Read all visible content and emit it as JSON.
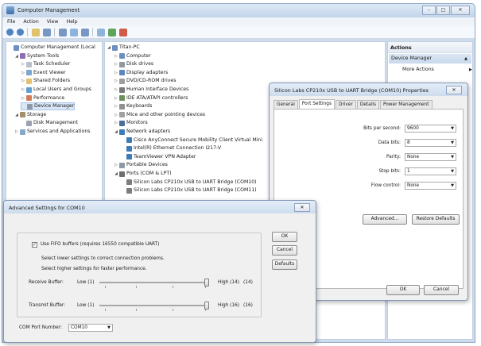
{
  "window": {
    "title": "Computer Management",
    "controls": {
      "minimize": "–",
      "maximize": "□",
      "close": "✕"
    }
  },
  "menu": [
    "File",
    "Action",
    "View",
    "Help"
  ],
  "toolbar_icons": [
    "back-icon",
    "forward-icon",
    "up-folder-icon",
    "show-tree-icon",
    "properties-icon",
    "help-icon",
    "console-icon",
    "scan-icon",
    "enable-icon",
    "disable-icon"
  ],
  "left_tree": [
    {
      "label": "Computer Management (Local",
      "level": 0,
      "tw": "",
      "icon": "c-comp",
      "name": "tree-computer-management"
    },
    {
      "label": "System Tools",
      "level": 1,
      "tw": "◢",
      "icon": "c-tool",
      "name": "tree-system-tools"
    },
    {
      "label": "Task Scheduler",
      "level": 2,
      "tw": "▷",
      "icon": "c-clock",
      "name": "tree-task-scheduler"
    },
    {
      "label": "Event Viewer",
      "level": 2,
      "tw": "▷",
      "icon": "c-log",
      "name": "tree-event-viewer"
    },
    {
      "label": "Shared Folders",
      "level": 2,
      "tw": "▷",
      "icon": "c-share",
      "name": "tree-shared-folders"
    },
    {
      "label": "Local Users and Groups",
      "level": 2,
      "tw": "▷",
      "icon": "c-user",
      "name": "tree-local-users"
    },
    {
      "label": "Performance",
      "level": 2,
      "tw": "▷",
      "icon": "c-perf",
      "name": "tree-performance"
    },
    {
      "label": "Device Manager",
      "level": 2,
      "tw": "",
      "icon": "c-dev",
      "name": "tree-device-manager",
      "selected": true
    },
    {
      "label": "Storage",
      "level": 1,
      "tw": "◢",
      "icon": "c-stor",
      "name": "tree-storage"
    },
    {
      "label": "Disk Management",
      "level": 2,
      "tw": "",
      "icon": "c-disk",
      "name": "tree-disk-management"
    },
    {
      "label": "Services and Applications",
      "level": 1,
      "tw": "▷",
      "icon": "c-svc",
      "name": "tree-services"
    }
  ],
  "device_tree": [
    {
      "label": "Titan-PC",
      "level": 0,
      "tw": "◢",
      "icon": "c-comp"
    },
    {
      "label": "Computer",
      "level": 1,
      "tw": "▷",
      "icon": "c-comp"
    },
    {
      "label": "Disk drives",
      "level": 1,
      "tw": "▷",
      "icon": "c-disk2"
    },
    {
      "label": "Display adapters",
      "level": 1,
      "tw": "▷",
      "icon": "c-disp"
    },
    {
      "label": "DVD/CD-ROM drives",
      "level": 1,
      "tw": "▷",
      "icon": "c-dvd"
    },
    {
      "label": "Human Interface Devices",
      "level": 1,
      "tw": "▷",
      "icon": "c-hid"
    },
    {
      "label": "IDE ATA/ATAPI controllers",
      "level": 1,
      "tw": "▷",
      "icon": "c-ide"
    },
    {
      "label": "Keyboards",
      "level": 1,
      "tw": "▷",
      "icon": "c-kbd"
    },
    {
      "label": "Mice and other pointing devices",
      "level": 1,
      "tw": "▷",
      "icon": "c-mouse"
    },
    {
      "label": "Monitors",
      "level": 1,
      "tw": "▷",
      "icon": "c-mon"
    },
    {
      "label": "Network adapters",
      "level": 1,
      "tw": "◢",
      "icon": "c-net"
    },
    {
      "label": "Cisco AnyConnect Secure Mobility Client Virtual Mini",
      "level": 2,
      "tw": "",
      "icon": "c-net"
    },
    {
      "label": "Intel(R) Ethernet Connection I217-V",
      "level": 2,
      "tw": "",
      "icon": "c-net"
    },
    {
      "label": "TeamViewer VPN Adapter",
      "level": 2,
      "tw": "",
      "icon": "c-net"
    },
    {
      "label": "Portable Devices",
      "level": 1,
      "tw": "▷",
      "icon": "c-dev"
    },
    {
      "label": "Ports (COM & LPT)",
      "level": 1,
      "tw": "◢",
      "icon": "c-port"
    },
    {
      "label": "Silicon Labs CP210x USB to UART Bridge (COM10)",
      "level": 2,
      "tw": "",
      "icon": "c-usb"
    },
    {
      "label": "Silicon Labs CP210x USB to UART Bridge (COM11)",
      "level": 2,
      "tw": "",
      "icon": "c-usb"
    }
  ],
  "actions": {
    "header": "Actions",
    "section": "Device Manager",
    "more": "More Actions"
  },
  "properties_dialog": {
    "title": "Silicon Labs CP210x USB to UART Bridge (COM10) Properties",
    "close": "✕",
    "tabs": [
      "General",
      "Port Settings",
      "Driver",
      "Details",
      "Power Management"
    ],
    "active_tab": "Port Settings",
    "fields": [
      {
        "label": "Bits per second:",
        "value": "9600",
        "name": "bits-per-second-select"
      },
      {
        "label": "Data bits:",
        "value": "8",
        "name": "data-bits-select"
      },
      {
        "label": "Parity:",
        "value": "None",
        "name": "parity-select"
      },
      {
        "label": "Stop bits:",
        "value": "1",
        "name": "stop-bits-select"
      },
      {
        "label": "Flow control:",
        "value": "None",
        "name": "flow-control-select"
      }
    ],
    "advanced_label": "Advanced...",
    "restore_label": "Restore Defaults",
    "ok_label": "OK",
    "cancel_label": "Cancel"
  },
  "advanced_dialog": {
    "title": "Advanced Settings for COM10",
    "close": "✕",
    "fifo_label": "Use FIFO buffers (requires 16550 compatible UART)",
    "fifo_checked": "✓",
    "hint_lower": "Select lower settings to correct connection problems.",
    "hint_higher": "Select higher settings for faster performance.",
    "receive": {
      "label": "Receive Buffer:",
      "low": "Low (1)",
      "high": "High (14)",
      "value": "(14)",
      "level": 1.0
    },
    "transmit": {
      "label": "Transmit Buffer:",
      "low": "Low (1)",
      "high": "High (16)",
      "value": "(16)",
      "level": 1.0
    },
    "com_port_label": "COM Port Number:",
    "com_port_value": "COM10",
    "ok_label": "OK",
    "cancel_label": "Cancel",
    "defaults_label": "Defaults"
  }
}
